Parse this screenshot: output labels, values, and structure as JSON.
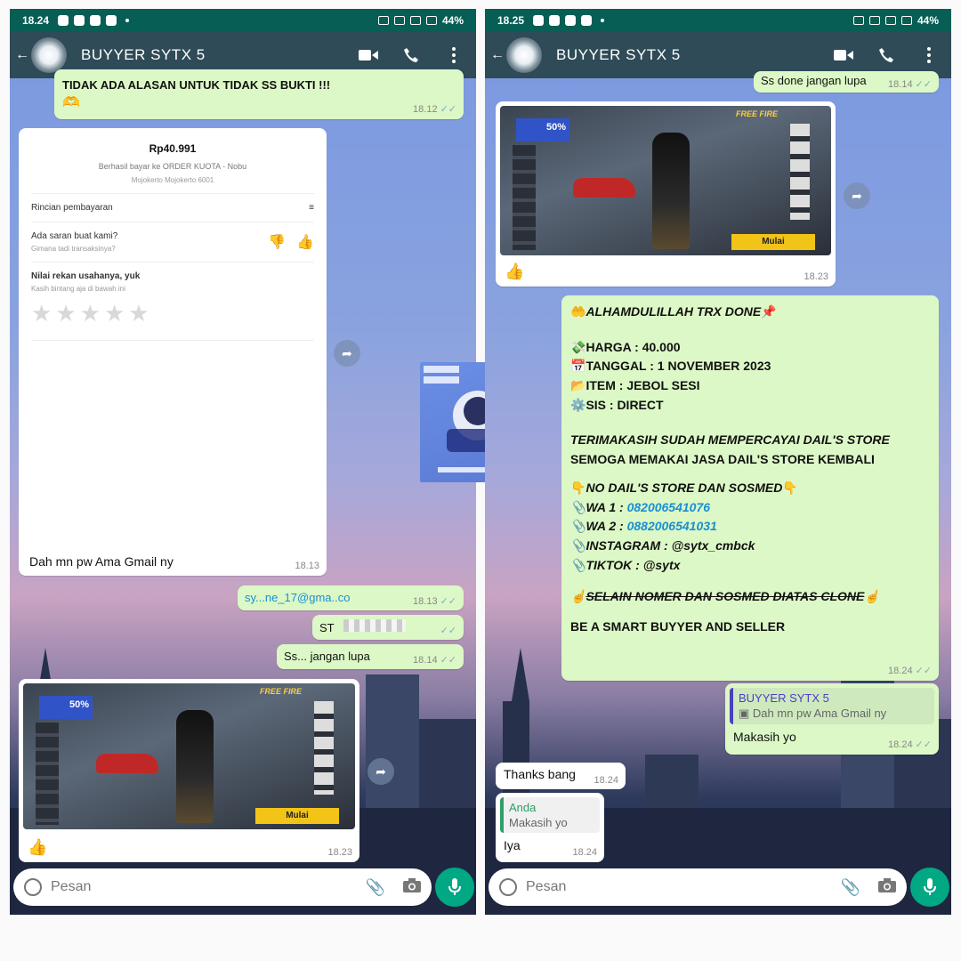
{
  "left": {
    "status": {
      "time": "18.24",
      "battery": "44%"
    },
    "contact_name": "BUYYER SYTX 5",
    "top_cut_text": "TIDAK ADA ALASAN UNTUK TIDAK SS BUKTI !!!",
    "top_cut_time": "18.12",
    "receipt": {
      "amount": "Rp40.991",
      "title": "Berhasil bayar ke ORDER KUOTA - Nobu",
      "subtitle": "Mojokerto Mojokerto 6001",
      "details_label": "Rincian pembayaran",
      "feedback_title": "Ada saran buat kami?",
      "feedback_sub": "Gimana tadi transaksinya?",
      "rate_title": "Nilai rekan usahanya, yuk",
      "rate_sub": "Kasih bintang aja di bawah ini",
      "caption": "Dah mn pw Ama Gmail ny",
      "time": "18.13"
    },
    "out_email": {
      "text": "sy...ne_17@gma..co",
      "time": "18.13"
    },
    "out_redacted": {
      "text": "ST"
    },
    "out_ss": {
      "text": "Ss... jangan lupa",
      "time": "18.14"
    },
    "game": {
      "promo": "50%",
      "logo": "FREE FIRE",
      "start": "Mulai",
      "emoji": "👍",
      "time": "18.23"
    },
    "composer_placeholder": "Pesan"
  },
  "right": {
    "status": {
      "time": "18.25",
      "battery": "44%"
    },
    "contact_name": "BUYYER SYTX 5",
    "top_cut_text": "Ss done jangan lupa",
    "top_cut_time": "18.14",
    "game": {
      "promo": "50%",
      "logo": "FREE FIRE",
      "start": "Mulai",
      "emoji": "👍",
      "time": "18.23"
    },
    "receipt_msg": {
      "line1": "ALHAMDULILLAH TRX DONE",
      "harga": "HARGA : 40.000",
      "tanggal": "TANGGAL : 1 NOVEMBER 2023",
      "item": "ITEM : JEBOL SESI",
      "sis": "SIS : DIRECT",
      "thanks1": "TERIMAKASIH SUDAH MEMPERCAYAI DAIL'S STORE",
      "thanks2": "SEMOGA MEMAKAI JASA DAIL'S STORE KEMBALI",
      "no_title": "NO DAIL'S STORE DAN SOSMED",
      "wa1_label": "WA 1 : ",
      "wa1": "082006541076",
      "wa2_label": "WA 2 : ",
      "wa2": "0882006541031",
      "ig": "INSTAGRAM : @sytx_cmbck",
      "tiktok": "TIKTOK : @sytx",
      "warning": "SELAIN NOMER DAN SOSMED DIATAS CLONE",
      "smart": "BE A SMART BUYYER AND SELLER",
      "time": "18.24"
    },
    "reply_out": {
      "author": "BUYYER SYTX 5",
      "quoted": "Dah mn pw Ama Gmail ny",
      "text": "Makasih yo",
      "time": "18.24"
    },
    "thanks_in": {
      "text": "Thanks bang",
      "time": "18.24"
    },
    "reply_in": {
      "author": "Anda",
      "quoted": "Makasih yo",
      "text": "Iya",
      "time": "18.24"
    },
    "composer_placeholder": "Pesan"
  },
  "colors": {
    "header": "#2e4b57",
    "statusbar": "#075e54",
    "outgoing": "#dcf8c6",
    "incoming": "#ffffff",
    "mic": "#00a884",
    "link": "#1a8fd4"
  }
}
